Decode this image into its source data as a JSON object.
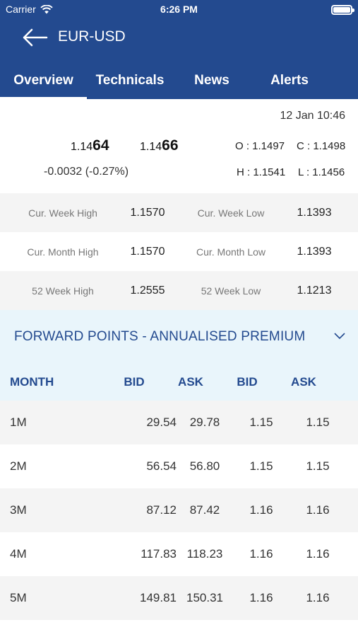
{
  "status_bar": {
    "carrier": "Carrier",
    "time": "6:26 PM"
  },
  "nav": {
    "title": "EUR-USD"
  },
  "tabs": [
    {
      "label": "Overview",
      "active": true
    },
    {
      "label": "Technicals",
      "active": false
    },
    {
      "label": "News",
      "active": false
    },
    {
      "label": "Alerts",
      "active": false
    }
  ],
  "quote": {
    "date": "12 Jan 10:46",
    "bid_prefix": "1.14",
    "bid_big": "64",
    "ask_prefix": "1.14",
    "ask_big": "66",
    "change": "-0.0032  (-0.27%)",
    "open": "O : 1.1497",
    "close": "C : 1.1498",
    "high": "H : 1.1541",
    "low": "L : 1.1456"
  },
  "stats": [
    {
      "label1": "Cur. Week High",
      "val1": "1.1570",
      "label2": "Cur. Week Low",
      "val2": "1.1393"
    },
    {
      "label1": "Cur. Month High",
      "val1": "1.1570",
      "label2": "Cur. Month Low",
      "val2": "1.1393"
    },
    {
      "label1": "52 Week High",
      "val1": "1.2555",
      "label2": "52 Week Low",
      "val2": "1.1213"
    }
  ],
  "forward": {
    "title": "FORWARD POINTS - ANNUALISED PREMIUM",
    "columns": [
      "MONTH",
      "BID",
      "ASK",
      "BID",
      "ASK"
    ],
    "rows": [
      [
        "1M",
        "29.54",
        "29.78",
        "1.15",
        "1.15"
      ],
      [
        "2M",
        "56.54",
        "56.80",
        "1.15",
        "1.15"
      ],
      [
        "3M",
        "87.12",
        "87.42",
        "1.16",
        "1.16"
      ],
      [
        "4M",
        "117.83",
        "118.23",
        "1.16",
        "1.16"
      ],
      [
        "5M",
        "149.81",
        "150.31",
        "1.16",
        "1.16"
      ]
    ]
  },
  "colors": {
    "brand": "#234a8f",
    "section_bg": "#e9f5fb",
    "row_shade": "#f4f4f4"
  }
}
